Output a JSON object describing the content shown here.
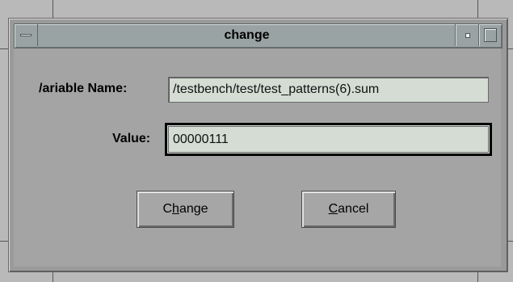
{
  "window": {
    "title": "change"
  },
  "form": {
    "variable_name_label": "/ariable Name:",
    "variable_name_value": "/testbench/test/test_patterns(6).sum",
    "value_label": "Value:",
    "value_value": "00000111"
  },
  "buttons": {
    "change_pre": "C",
    "change_mnemonic": "h",
    "change_post": "ange",
    "cancel_mnemonic": "C",
    "cancel_post": "ancel"
  },
  "icons": {
    "window_menu": "window-menu-icon",
    "minimize": "minimize-icon",
    "maximize": "maximize-icon"
  }
}
